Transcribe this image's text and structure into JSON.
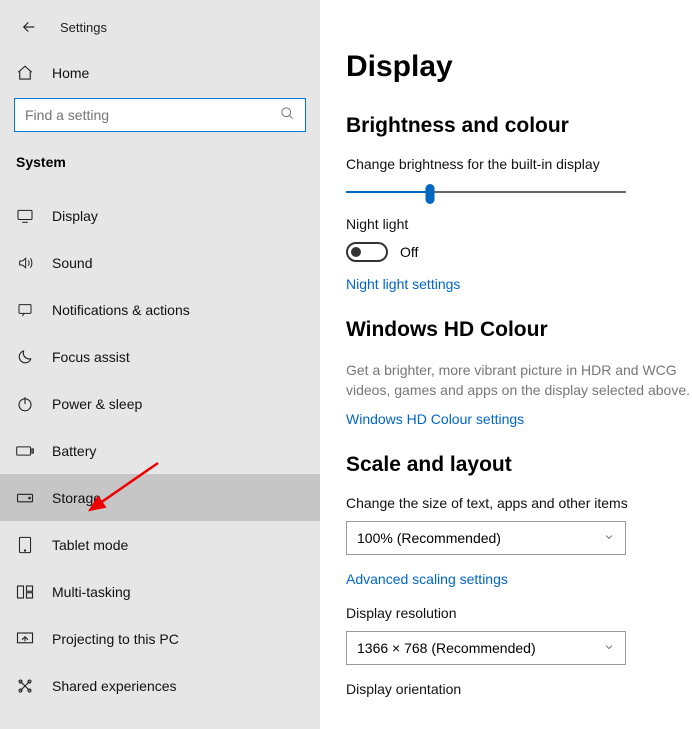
{
  "header": {
    "title": "Settings",
    "home": "Home"
  },
  "search": {
    "placeholder": "Find a setting"
  },
  "section": "System",
  "nav": [
    {
      "label": "Display"
    },
    {
      "label": "Sound"
    },
    {
      "label": "Notifications & actions"
    },
    {
      "label": "Focus assist"
    },
    {
      "label": "Power & sleep"
    },
    {
      "label": "Battery"
    },
    {
      "label": "Storage"
    },
    {
      "label": "Tablet mode"
    },
    {
      "label": "Multi-tasking"
    },
    {
      "label": "Projecting to this PC"
    },
    {
      "label": "Shared experiences"
    }
  ],
  "content": {
    "page_title": "Display",
    "brightness": {
      "heading": "Brightness and colour",
      "slider_label": "Change brightness for the built-in display",
      "night_label": "Night light",
      "night_state": "Off",
      "night_link": "Night light settings"
    },
    "hdcolour": {
      "heading": "Windows HD Colour",
      "desc": "Get a brighter, more vibrant picture in HDR and WCG videos, games and apps on the display selected above.",
      "link": "Windows HD Colour settings"
    },
    "scale": {
      "heading": "Scale and layout",
      "size_label": "Change the size of text, apps and other items",
      "size_value": "100% (Recommended)",
      "adv_link": "Advanced scaling settings",
      "res_label": "Display resolution",
      "res_value": "1366 × 768 (Recommended)",
      "orient_label": "Display orientation"
    }
  }
}
